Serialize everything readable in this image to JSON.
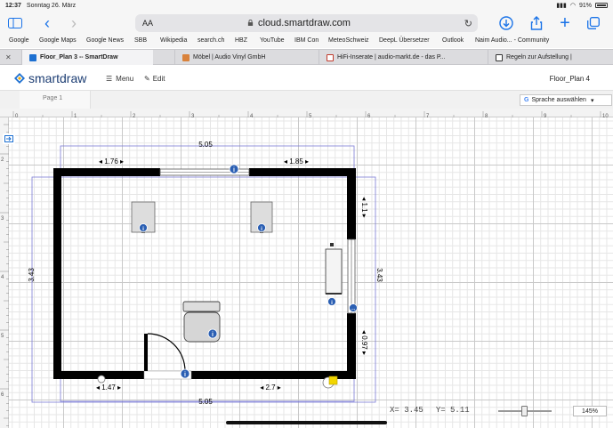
{
  "status": {
    "time": "12:37",
    "date": "Sonntag 26. März",
    "battery": "91%"
  },
  "browser": {
    "aa": "AA",
    "url": "cloud.smartdraw.com"
  },
  "bookmarks": [
    "Google",
    "Google Maps",
    "Google News",
    "SBB",
    "Wikipedia",
    "search.ch",
    "HBZ",
    "YouTube",
    "IBM Con",
    "MeteoSchweiz",
    "DeepL Übersetzer",
    "Outlook",
    "Naim Audio... - Community"
  ],
  "tabs": [
    {
      "label": "Floor_Plan 3 -- SmartDraw",
      "color": "#1c6fd1",
      "active": true
    },
    {
      "label": "Möbel | Audio Vinyl GmbH",
      "color": "#d9823b",
      "active": false
    },
    {
      "label": "HiFi-Inserate | audio-markt.de - das P...",
      "color": "#c0392b",
      "active": false
    },
    {
      "label": "Regeln zur Aufstellung |",
      "color": "#333333",
      "active": false
    }
  ],
  "app": {
    "logo": "smartdraw",
    "menu": "Menu",
    "edit": "Edit",
    "doc_title": "Floor_Plan 4",
    "page_tab": "Page 1",
    "language": "Sprache auswählen"
  },
  "ruler": {
    "top": [
      "0",
      "1",
      "2",
      "3",
      "4",
      "5",
      "6",
      "7",
      "8",
      "9",
      "10"
    ],
    "left": [
      "2",
      "3",
      "4",
      "5",
      "6"
    ]
  },
  "dimensions": {
    "top_total": "5.05",
    "bottom_total": "5.05",
    "left_height": "3.43",
    "right_height": "3.43",
    "top_left": "1.76",
    "top_right": "1.85",
    "right_top": "1.1",
    "right_bottom": "0.97",
    "bottom_left": "1.47",
    "bottom_right": "2.7"
  },
  "status_bar": {
    "x": "X= 3.45",
    "y": "Y= 5.11",
    "zoom": "145%"
  }
}
